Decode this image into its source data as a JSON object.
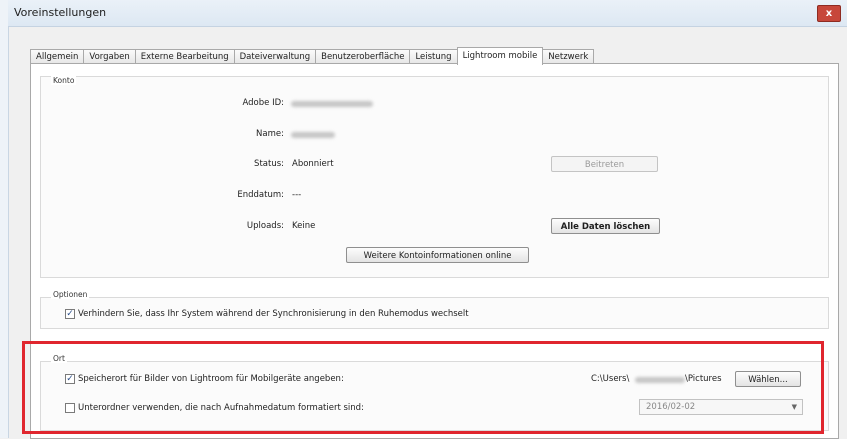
{
  "window": {
    "title": "Voreinstellungen",
    "close_label": "x"
  },
  "tabs": [
    {
      "label": "Allgemein"
    },
    {
      "label": "Vorgaben"
    },
    {
      "label": "Externe Bearbeitung"
    },
    {
      "label": "Dateiverwaltung"
    },
    {
      "label": "Benutzeroberfläche"
    },
    {
      "label": "Leistung"
    },
    {
      "label": "Lightroom mobile"
    },
    {
      "label": "Netzwerk"
    }
  ],
  "account": {
    "section_title": "Konto",
    "adobe_id_label": "Adobe ID:",
    "name_label": "Name:",
    "status_label": "Status:",
    "status_value": "Abonniert",
    "end_date_label": "Enddatum:",
    "end_date_value": "---",
    "uploads_label": "Uploads:",
    "uploads_value": "Keine",
    "join_button": "Beitreten",
    "delete_all_button": "Alle Daten löschen",
    "more_info_button": "Weitere Kontoinformationen online"
  },
  "options": {
    "section_title": "Optionen",
    "prevent_sleep_label": "Verhindern Sie, dass Ihr System während der Synchronisierung in den Ruhemodus wechselt",
    "prevent_sleep_checked": true
  },
  "location": {
    "section_title": "Ort",
    "specify_location_label": "Speicherort für Bilder von Lightroom für Mobilgeräte angeben:",
    "specify_location_checked": true,
    "path_prefix": "C:\\Users\\",
    "path_suffix": "\\Pictures",
    "choose_button": "Wählen...",
    "subfolder_label": "Unterordner verwenden, die nach Aufnahmedatum formatiert sind:",
    "subfolder_checked": false,
    "date_format_value": "2016/02-02"
  },
  "icons": {
    "checkmark": "✓",
    "chevron": "▼"
  },
  "colors": {
    "highlight_border": "#e0262e",
    "close_button": "#c7473a"
  }
}
